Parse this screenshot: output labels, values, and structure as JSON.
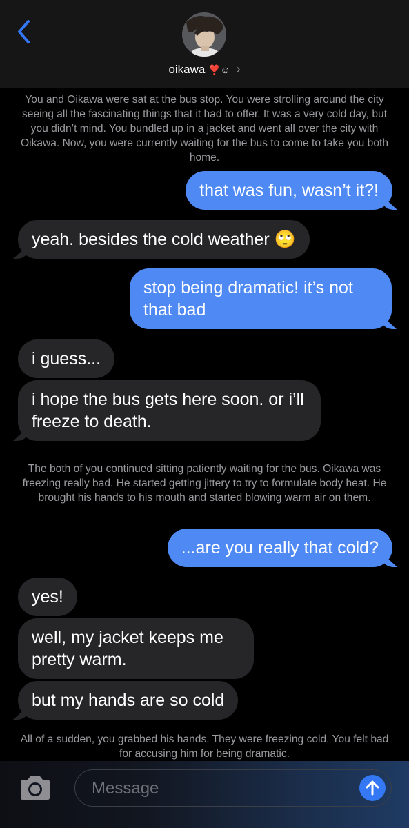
{
  "header": {
    "contact_name": "oikawa",
    "contact_emoji": "❣️☺",
    "chevron": "›",
    "back_icon": "chevron-left-icon",
    "accent": "#3478f6"
  },
  "narration": {
    "first": "You and Oikawa were sat at the bus stop. You were strolling around the city seeing all the fascinating things that it had to offer. It was a very cold day, but you didn’t mind. You bundled up in a jacket and went all over the city with Oikawa. Now, you were currently waiting for the bus to come to take you both home.",
    "second": "The both of you continued sitting patiently waiting for the bus. Oikawa was freezing really bad. He started getting jittery to try to formulate body heat. He brought his hands to his mouth and started blowing warm air on them.",
    "third": "All of a sudden, you grabbed his hands. They were freezing cold. You felt bad for accusing him for being dramatic."
  },
  "messages": {
    "m1": "that was fun, wasn’t it?!",
    "m2": "yeah. besides the cold weather 🙄",
    "m3": "stop being dramatic! it’s not that bad",
    "m4": "i guess...",
    "m5": "i hope the bus gets here soon. or i’ll freeze to death.",
    "m6": "...are you really that cold?",
    "m7": "yes!",
    "m8": "well, my jacket keeps me pretty warm.",
    "m9": "but my hands are so cold"
  },
  "composer": {
    "placeholder": "Message",
    "camera_icon": "camera-icon",
    "send_icon": "send-arrow-icon"
  },
  "colors": {
    "outgoing": "#4f8af4",
    "incoming": "#262628",
    "narration_text": "#9a9a9f"
  }
}
